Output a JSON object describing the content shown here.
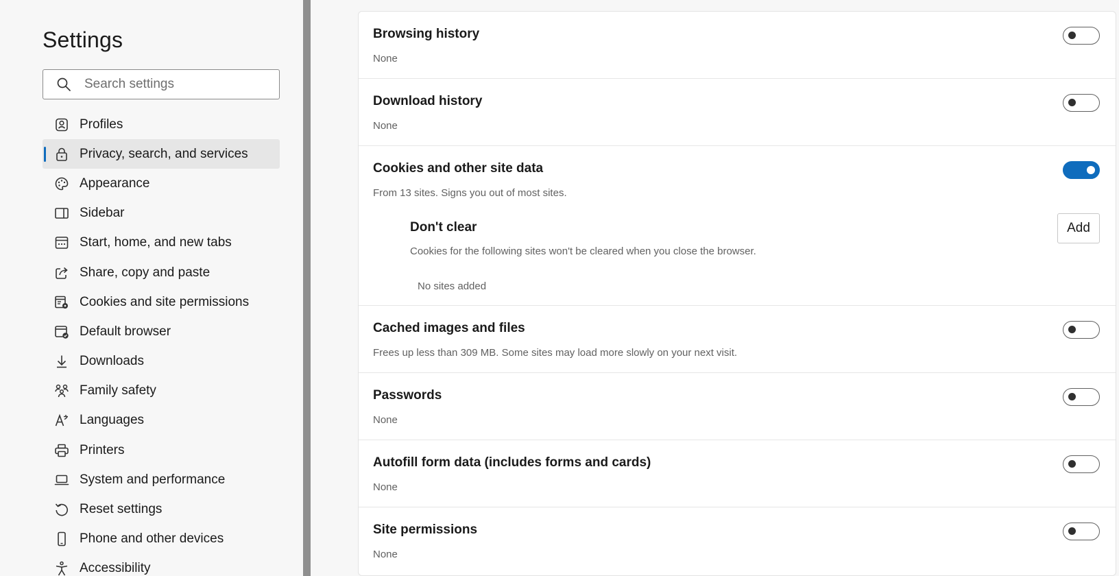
{
  "sidebar": {
    "title": "Settings",
    "search_placeholder": "Search settings",
    "items": [
      {
        "label": "Profiles",
        "icon": "profile-icon"
      },
      {
        "label": "Privacy, search, and services",
        "icon": "lock-icon",
        "active": true
      },
      {
        "label": "Appearance",
        "icon": "palette-icon"
      },
      {
        "label": "Sidebar",
        "icon": "sidebar-icon"
      },
      {
        "label": "Start, home, and new tabs",
        "icon": "home-tabs-icon"
      },
      {
        "label": "Share, copy and paste",
        "icon": "share-icon"
      },
      {
        "label": "Cookies and site permissions",
        "icon": "cookies-permissions-icon"
      },
      {
        "label": "Default browser",
        "icon": "default-browser-icon"
      },
      {
        "label": "Downloads",
        "icon": "download-icon"
      },
      {
        "label": "Family safety",
        "icon": "family-icon"
      },
      {
        "label": "Languages",
        "icon": "languages-icon"
      },
      {
        "label": "Printers",
        "icon": "printer-icon"
      },
      {
        "label": "System and performance",
        "icon": "laptop-icon"
      },
      {
        "label": "Reset settings",
        "icon": "reset-icon"
      },
      {
        "label": "Phone and other devices",
        "icon": "phone-icon"
      },
      {
        "label": "Accessibility",
        "icon": "accessibility-icon"
      }
    ]
  },
  "main": {
    "rows": [
      {
        "title": "Browsing history",
        "subtitle": "None",
        "enabled": false
      },
      {
        "title": "Download history",
        "subtitle": "None",
        "enabled": false
      },
      {
        "title": "Cookies and other site data",
        "subtitle": "From 13 sites. Signs you out of most sites.",
        "enabled": true
      },
      {
        "title": "Cached images and files",
        "subtitle": "Frees up less than 309 MB. Some sites may load more slowly on your next visit.",
        "enabled": false
      },
      {
        "title": "Passwords",
        "subtitle": "None",
        "enabled": false
      },
      {
        "title": "Autofill form data (includes forms and cards)",
        "subtitle": "None",
        "enabled": false
      },
      {
        "title": "Site permissions",
        "subtitle": "None",
        "enabled": false
      }
    ],
    "dont_clear": {
      "title": "Don't clear",
      "description": "Cookies for the following sites won't be cleared when you close the browser.",
      "add_label": "Add",
      "empty_text": "No sites added"
    }
  },
  "colors": {
    "accent": "#0f6cbd",
    "active_nav_bg": "#e6e6e6",
    "page_bg": "#f7f7f7",
    "panel_bg": "#ffffff",
    "secondary_text": "#616161"
  }
}
